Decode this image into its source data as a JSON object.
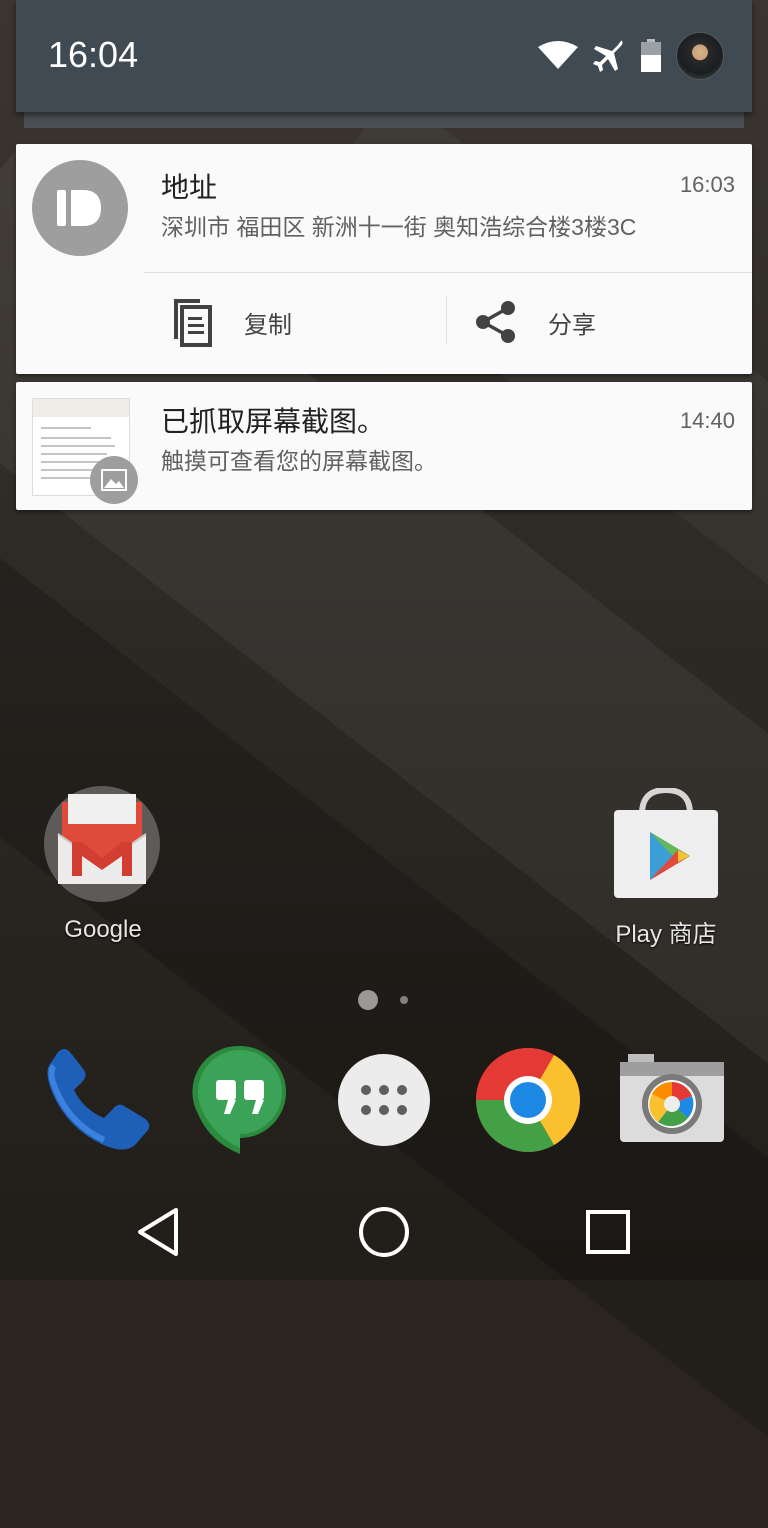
{
  "status_bar": {
    "time": "16:04",
    "icons": [
      "wifi-icon",
      "airplane-mode-icon",
      "battery-icon",
      "user-avatar"
    ]
  },
  "notifications": [
    {
      "icon": "pushbullet-icon",
      "title": "地址",
      "text": "深圳市 福田区 新洲十一街 奥知浩综合楼3楼3C",
      "time": "16:03",
      "actions": [
        {
          "icon": "copy-icon",
          "label": "复制"
        },
        {
          "icon": "share-icon",
          "label": "分享"
        }
      ]
    },
    {
      "icon": "screenshot-thumbnail",
      "title": "已抓取屏幕截图。",
      "text": "触摸可查看您的屏幕截图。",
      "time": "14:40"
    }
  ],
  "home": {
    "apps": [
      {
        "name": "gmail-app",
        "label": "Google"
      },
      {
        "name": "play-store-app",
        "label": "Play 商店"
      }
    ],
    "dock": [
      "phone-icon",
      "hangouts-icon",
      "app-drawer-icon",
      "chrome-icon",
      "camera-icon"
    ]
  },
  "navigation": [
    "back-button",
    "home-button",
    "recents-button"
  ],
  "colors": {
    "header": "#3f4a52",
    "card": "#fafafa",
    "title_text": "#212121",
    "body_text": "#616161"
  }
}
